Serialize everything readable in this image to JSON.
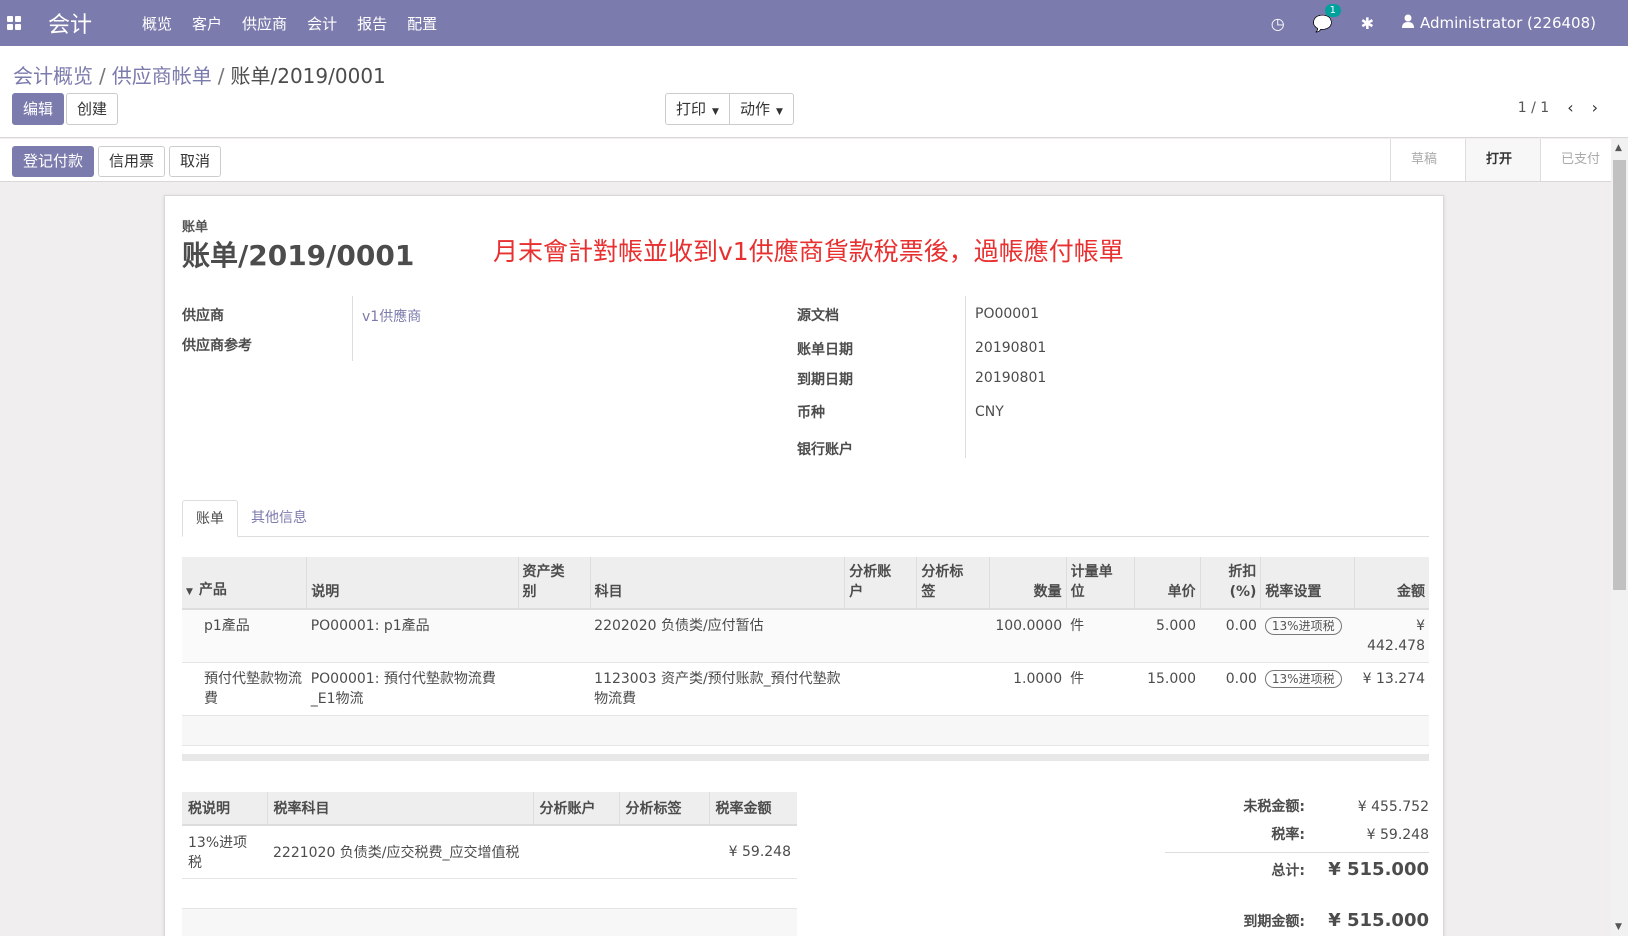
{
  "navbar": {
    "app_name": "会计",
    "menu": [
      "概览",
      "客户",
      "供应商",
      "会计",
      "报告",
      "配置"
    ],
    "clock_icon": "◷",
    "chat_icon": "💬",
    "chat_badge": "1",
    "bug_icon": "✱",
    "user": "Administrator (226408)"
  },
  "breadcrumb": {
    "items": [
      "会计概览",
      "供应商帐单",
      "账单/2019/0001"
    ],
    "sep": "/"
  },
  "toolbar": {
    "edit": "编辑",
    "create": "创建",
    "print": "打印",
    "action": "动作",
    "pager": "1 / 1",
    "prev": "‹",
    "next": "›"
  },
  "status": {
    "buttons": [
      "登记付款",
      "信用票",
      "取消"
    ],
    "stages": [
      "草稿",
      "打开",
      "已支付"
    ],
    "active_stage": "打开"
  },
  "sheet": {
    "doc_type": "账单",
    "title": "账单/2019/0001",
    "annotation": "月末會計對帳並收到v1供應商貨款稅票後，過帳應付帳單",
    "left_fields": [
      {
        "label": "供应商",
        "value": "v1供應商"
      },
      {
        "label": "供应商参考",
        "value": ""
      }
    ],
    "right_fields": [
      {
        "label": "源文档",
        "value": "PO00001"
      },
      {
        "label": "账单日期",
        "value": "20190801"
      },
      {
        "label": "到期日期",
        "value": "20190801"
      },
      {
        "label": "币种",
        "value": "CNY"
      },
      {
        "label": "银行账户",
        "value": ""
      }
    ],
    "tabs": [
      "账单",
      "其他信息"
    ]
  },
  "lines": {
    "headers": [
      "产品",
      "说明",
      "资产类别",
      "科目",
      "分析账户",
      "分析标签",
      "数量",
      "计量单位",
      "单价",
      "折扣(%)",
      "税率设置",
      "金额"
    ],
    "header_display": {
      "asset1": "资产类",
      "asset2": "别",
      "acc1": "分析账",
      "acc2": "户",
      "tag1": "分析标",
      "tag2": "签",
      "uom1": "计量单",
      "uom2": "位",
      "disc1": "折扣",
      "disc2": "(%)"
    },
    "rows": [
      {
        "product": "p1產品",
        "desc": "PO00001: p1產品",
        "account": "2202020 负债类/应付暂估",
        "qty": "100.0000",
        "uom": "件",
        "price": "5.000",
        "discount": "0.00",
        "tax": "13%进项税",
        "amount": "¥ 442.478"
      },
      {
        "product": "預付代墊款物流費",
        "desc": "PO00001: 預付代墊款物流費_E1物流",
        "account": "1123003 资产类/预付账款_預付代墊款物流費",
        "qty": "1.0000",
        "uom": "件",
        "price": "15.000",
        "discount": "0.00",
        "tax": "13%进项税",
        "amount": "¥ 13.274"
      }
    ]
  },
  "taxes": {
    "headers": [
      "税说明",
      "税率科目",
      "分析账户",
      "分析标签",
      "税率金额"
    ],
    "rows": [
      {
        "desc": "13%进项税",
        "account": "2221020 负债类/应交税费_应交增值税",
        "amount": "¥ 59.248"
      }
    ]
  },
  "totals": {
    "untaxed_label": "未税金额:",
    "untaxed": "¥ 455.752",
    "tax_label": "税率:",
    "tax": "¥ 59.248",
    "total_label": "总计:",
    "total": "¥ 515.000",
    "due_label": "到期金额:",
    "due": "¥ 515.000"
  },
  "colors": {
    "brand": "#7c7bad",
    "annotation": "#e83030"
  }
}
